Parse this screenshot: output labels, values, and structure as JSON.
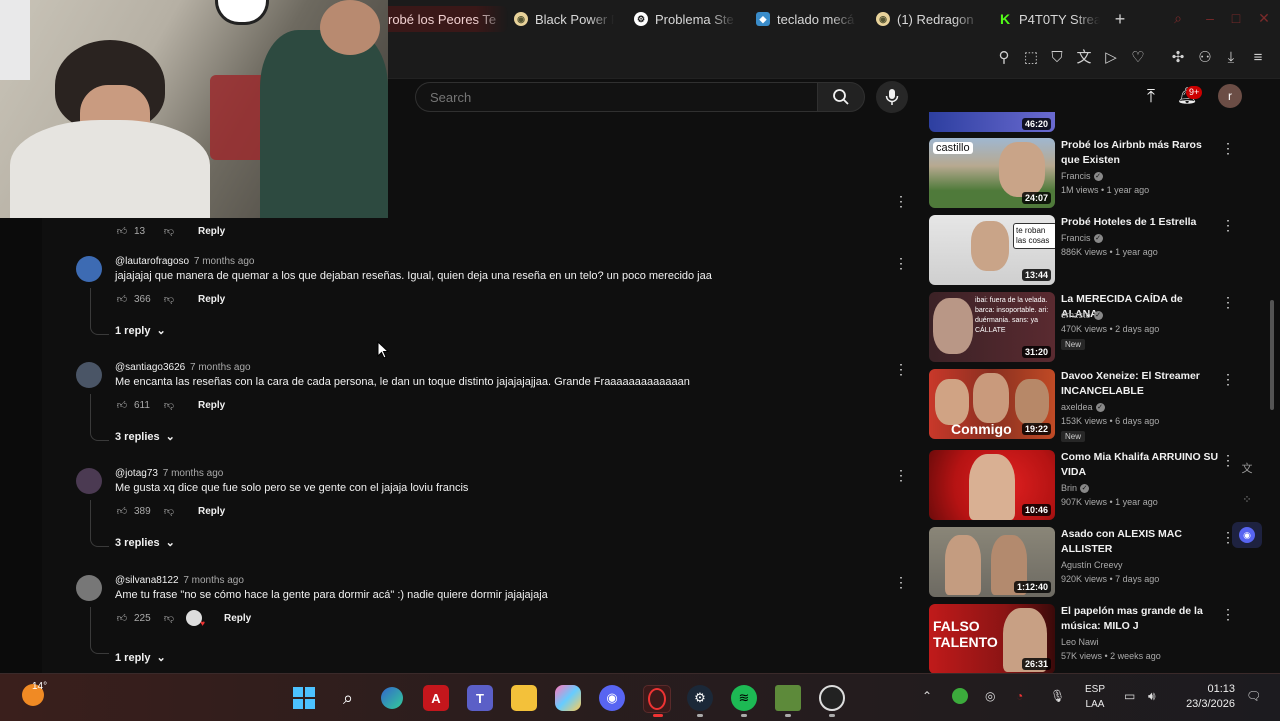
{
  "browser": {
    "tabs": [
      {
        "label": "robé los Peores Te",
        "active": true
      },
      {
        "label": "Black Power F",
        "active": false
      },
      {
        "label": "Problema Ste",
        "active": false
      },
      {
        "label": "teclado mecá",
        "active": false
      },
      {
        "label": "(1) Redragon",
        "active": false
      },
      {
        "label": "P4T0TY Strea",
        "active": false
      }
    ]
  },
  "masthead": {
    "search_placeholder": "Search",
    "notification_count": "9+",
    "user_initial": "r"
  },
  "comments": [
    {
      "likes": "13",
      "reply_label": "Reply"
    },
    {
      "author": "@lautarofragoso",
      "time": "7 months ago",
      "text": "jajajajaj que manera de quemar a los que dejaban reseñas. Igual, quien deja una reseña en un telo? un poco merecido jaa",
      "likes": "366",
      "reply_label": "Reply",
      "replies_label": "1 reply",
      "avatar_color": "#3d6bb3"
    },
    {
      "author": "@santiago3626",
      "time": "7 months ago",
      "text": "Me encanta las reseñas con la cara de cada persona, le dan un toque distinto jajajajajjaa. Grande Fraaaaaaaaaaaaan",
      "likes": "611",
      "reply_label": "Reply",
      "replies_label": "3 replies",
      "avatar_color": "#4a5566"
    },
    {
      "author": "@jotag73",
      "time": "7 months ago",
      "text": "Me gusta xq dice que fue solo pero se ve gente con el jajaja loviu francis",
      "likes": "389",
      "reply_label": "Reply",
      "replies_label": "3 replies",
      "avatar_color": "#4b3a52"
    },
    {
      "author": "@silvana8122",
      "time": "7 months ago",
      "text": "Ame tu frase \"no se cómo hace la gente para dormir acá\" :) nadie quiere dormir jajajajaja",
      "likes": "225",
      "reply_label": "Reply",
      "replies_label": "1 reply",
      "avatar_color": "#777777"
    }
  ],
  "sidebar": {
    "videos": [
      {
        "duration": "46:20"
      },
      {
        "title": "Probé los Airbnb más Raros que Existen",
        "channel": "Francis",
        "meta": "1M views • 1 year ago",
        "duration": "24:07",
        "thumb_text": "castillo",
        "thumb_bg": "#4f7a3a"
      },
      {
        "title": "Probé Hoteles de 1 Estrella",
        "channel": "Francis",
        "meta": "886K views • 1 year ago",
        "duration": "13:44",
        "thumb_text": "te roban las cosas",
        "thumb_bg": "#cfcfcf"
      },
      {
        "title": "La MERECIDA CAÍDA de ALANA",
        "channel": "ernzsto",
        "meta": "470K views • 2 days ago",
        "duration": "31:20",
        "new_badge": "New",
        "thumb_text": "ibai: fuera de la velada. barca: insoportable. ari: duérmania. sans: ya CÁLLATE",
        "thumb_bg": "#5a2a30"
      },
      {
        "title": "Davoo Xeneize: El Streamer INCANCELABLE",
        "channel": "axeldea",
        "meta": "153K views • 6 days ago",
        "duration": "19:22",
        "new_badge": "New",
        "thumb_text": "Conmigo",
        "thumb_bg": "#8a3020"
      },
      {
        "title": "Como Mia Khalifa ARRUINO SU VIDA",
        "channel": "Brin",
        "meta": "907K views • 1 year ago",
        "duration": "10:46",
        "thumb_bg": "#b51313"
      },
      {
        "title": "Asado con ALEXIS MAC ALLISTER",
        "channel": "Agustín Creevy",
        "meta": "920K views • 7 days ago",
        "duration": "1:12:40",
        "thumb_bg": "#6d6a62"
      },
      {
        "title": "El papelón mas grande de la música: MILO J",
        "channel": "Leo Nawi",
        "meta": "57K views • 2 weeks ago",
        "duration": "26:31",
        "thumb_text": "FALSO TALENTO",
        "thumb_bg": "#8b1414"
      }
    ]
  },
  "taskbar": {
    "temperature": "14°",
    "language": "ESP",
    "keyboard_layout": "LAA",
    "time": "01:13",
    "date": "23/3/2026"
  }
}
